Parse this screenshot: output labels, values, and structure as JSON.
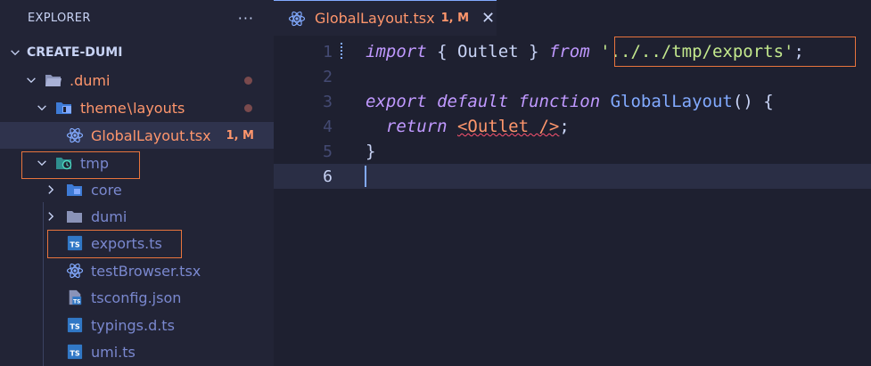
{
  "explorer": {
    "title": "EXPLORER",
    "more_icon": "···",
    "root": "CREATE-DUMI",
    "items": [
      {
        "label": ".dumi"
      },
      {
        "label_a": "theme",
        "label_sep": "\\",
        "label_b": "layouts"
      },
      {
        "label": "GlobalLayout.tsx",
        "badge": "1, M"
      },
      {
        "label": "tmp"
      },
      {
        "label": "core"
      },
      {
        "label": "dumi"
      },
      {
        "label": "exports.ts"
      },
      {
        "label": "testBrowser.tsx"
      },
      {
        "label": "tsconfig.json"
      },
      {
        "label": "typings.d.ts"
      },
      {
        "label": "umi.ts"
      }
    ]
  },
  "tab": {
    "title": "GlobalLayout.tsx",
    "badge": "1, M",
    "close": "✕"
  },
  "code": {
    "line_numbers": [
      "1",
      "2",
      "3",
      "4",
      "5",
      "6"
    ],
    "l1": {
      "kw1": "import",
      "p1": " { Outlet } ",
      "kw2": "from",
      "p2": " ",
      "str": "'../../tmp/exports'",
      "end": ";"
    },
    "l3": {
      "kw1": "export",
      "p1": " ",
      "kw2": "default",
      "p2": " ",
      "kw3": "function",
      "p3": " ",
      "fn": "GlobalLayout",
      "end": "() {"
    },
    "l4": {
      "ind": "  ",
      "kw": "return",
      "p": " ",
      "tag": "<Outlet />",
      "end": ";"
    },
    "l5": {
      "txt": "}"
    }
  },
  "colors": {
    "accent": "#82aaff",
    "modified": "#ff966c",
    "highlight_box": "#e8743d"
  }
}
